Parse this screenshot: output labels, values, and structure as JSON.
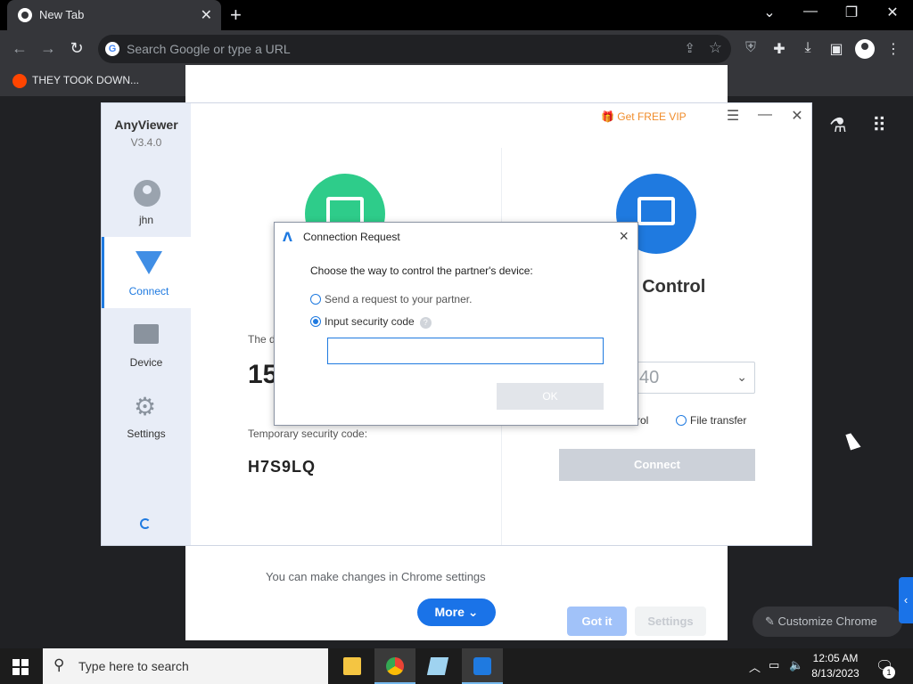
{
  "browser": {
    "tab_title": "New Tab",
    "tab_close": "✕",
    "new_tab": "+",
    "window_controls": {
      "dropdown": "⌄",
      "minimize": "—",
      "restore": "❐",
      "close": "✕"
    },
    "omnibox_placeholder": "Search Google or type a URL",
    "bookmark": "THEY TOOK DOWN...",
    "icons": [
      "back-icon",
      "forward-icon",
      "reload-icon",
      "share-icon",
      "star-icon",
      "ublock-icon",
      "extensions-icon",
      "download-icon",
      "sidepanel-icon",
      "profile-icon",
      "menu-icon"
    ]
  },
  "newtab_page": {
    "notice": "You can make changes in Chrome settings",
    "more_label": "More",
    "gotit_label": "Got it",
    "settings_label": "Settings",
    "customize_label": "Customize Chrome"
  },
  "anyviewer": {
    "app_name": "AnyViewer",
    "version": "V3.4.0",
    "user": "jhn",
    "nav": [
      "Connect",
      "Device",
      "Settings"
    ],
    "vip_label": "Get FREE VIP",
    "device_id_label": "The d",
    "device_id": "15",
    "temp_code_label": "Temporary security code:",
    "temp_code": "H7S9LQ",
    "remote_title": "t Control",
    "partner_id_partial": "40",
    "option_remote": "rol",
    "option_file": "File transfer",
    "connect_label": "Connect"
  },
  "dialog": {
    "title": "Connection Request",
    "prompt": "Choose the way to control the partner's device:",
    "option_request": "Send a request to your partner.",
    "option_code": "Input security code",
    "help": "?",
    "code_value": "",
    "ok_label": "OK"
  },
  "taskbar": {
    "search_placeholder": "Type here to search",
    "time": "12:05 AM",
    "date": "8/13/2023",
    "notification_count": "1"
  },
  "colors": {
    "accent": "#1f7ae0",
    "chrome_blue": "#1a73e8",
    "green": "#2ecc8a",
    "vip_orange": "#f08c2a"
  }
}
